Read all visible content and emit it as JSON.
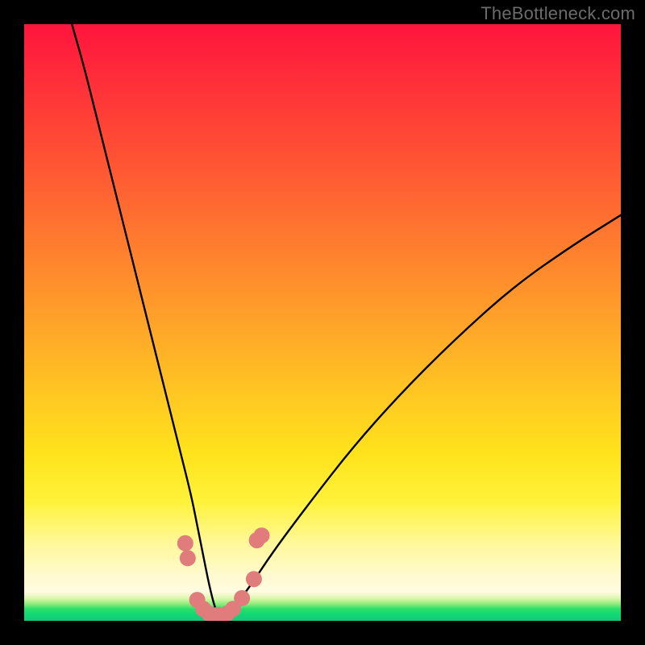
{
  "watermark": "TheBottleneck.com",
  "chart_data": {
    "type": "line",
    "title": "",
    "xlabel": "",
    "ylabel": "",
    "xlim": [
      0,
      100
    ],
    "ylim": [
      0,
      100
    ],
    "grid": false,
    "series": [
      {
        "name": "bottleneck-curve",
        "x": [
          8,
          10,
          12,
          14,
          16,
          18,
          20,
          22,
          24,
          26,
          28,
          29,
          30,
          31,
          32,
          33,
          35,
          38,
          42,
          48,
          55,
          63,
          72,
          82,
          92,
          100
        ],
        "values": [
          100,
          93,
          85,
          77,
          69,
          61,
          53,
          45,
          37,
          29,
          21,
          16,
          11,
          6,
          2,
          0,
          2,
          6,
          12,
          20,
          29,
          38,
          47,
          56,
          63,
          68
        ]
      }
    ],
    "markers": {
      "name": "highlight-points",
      "color": "#e07c7c",
      "points": [
        {
          "x": 27.0,
          "y": 13.0
        },
        {
          "x": 27.4,
          "y": 10.5
        },
        {
          "x": 29.0,
          "y": 3.5
        },
        {
          "x": 30.0,
          "y": 2.0
        },
        {
          "x": 31.0,
          "y": 1.2
        },
        {
          "x": 32.5,
          "y": 1.0
        },
        {
          "x": 34.0,
          "y": 1.2
        },
        {
          "x": 35.0,
          "y": 2.0
        },
        {
          "x": 36.5,
          "y": 3.8
        },
        {
          "x": 38.5,
          "y": 7.0
        },
        {
          "x": 39.0,
          "y": 13.5
        },
        {
          "x": 39.8,
          "y": 14.3
        }
      ]
    },
    "background_gradient": {
      "direction": "top-to-bottom",
      "stops": [
        {
          "pos": 0.0,
          "color": "#ff153c"
        },
        {
          "pos": 0.22,
          "color": "#ff5134"
        },
        {
          "pos": 0.5,
          "color": "#ffa329"
        },
        {
          "pos": 0.72,
          "color": "#ffe31c"
        },
        {
          "pos": 0.88,
          "color": "#fff89a"
        },
        {
          "pos": 0.96,
          "color": "#d8f7a8"
        },
        {
          "pos": 0.98,
          "color": "#29e06a"
        },
        {
          "pos": 1.0,
          "color": "#18c77a"
        }
      ]
    }
  }
}
